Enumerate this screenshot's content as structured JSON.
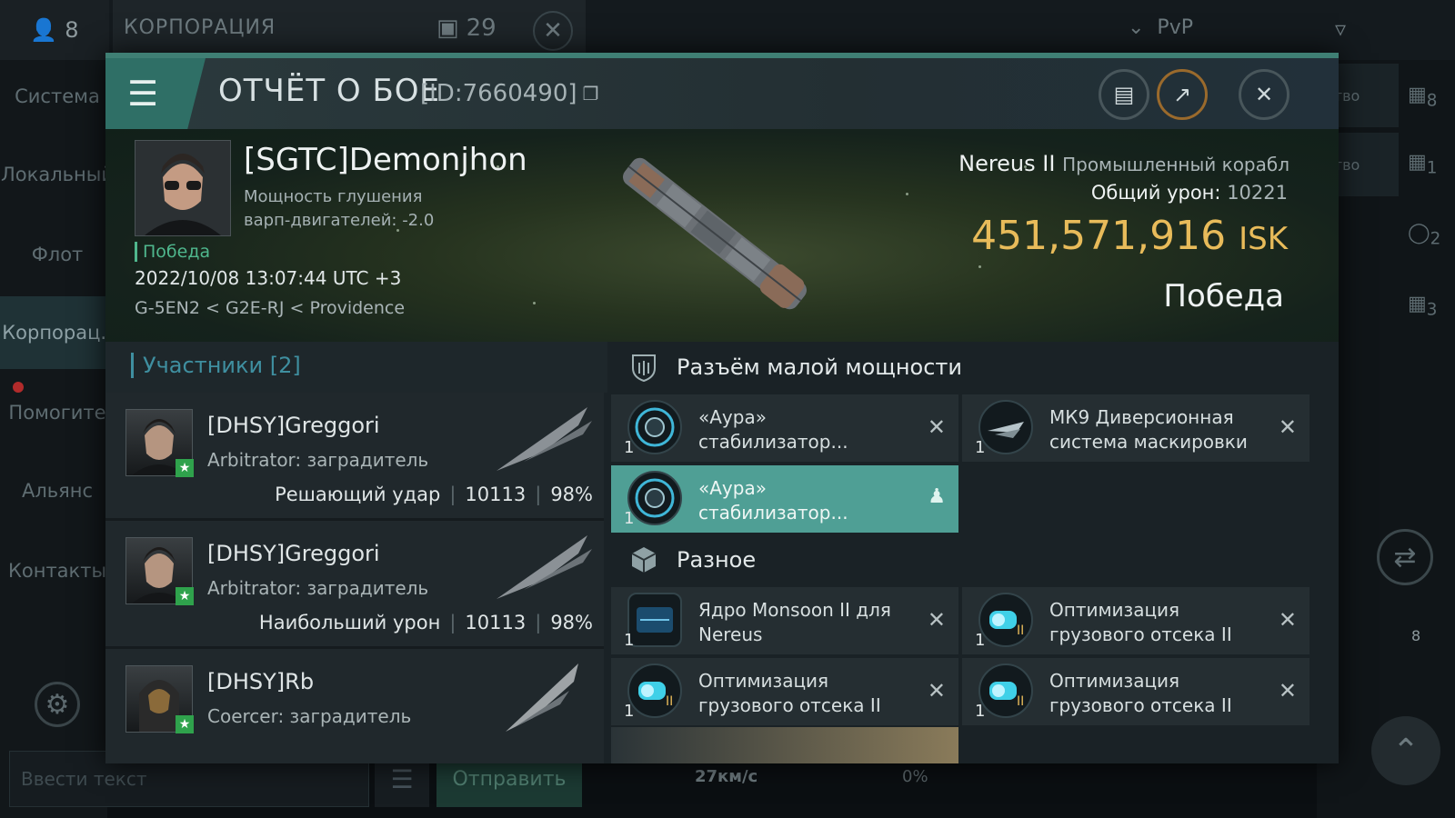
{
  "topbar": {
    "member_count": "8",
    "corp_title": "КОРПОРАЦИЯ",
    "message_count": "29",
    "pvp_label": "PvP"
  },
  "sidebar": {
    "items": [
      {
        "label": "Система"
      },
      {
        "label": "Локальный"
      },
      {
        "label": "Флот"
      },
      {
        "label": "Корпорац.."
      },
      {
        "label": "Помогите"
      },
      {
        "label": "Альянс"
      },
      {
        "label": "Контакты"
      }
    ]
  },
  "chat": {
    "input_placeholder": "Ввести текст",
    "send_label": "Отправить"
  },
  "right_panel": {
    "tabs": [
      {
        "label": "ство"
      },
      {
        "label": "ство"
      }
    ],
    "icon_counts": [
      "8",
      "1",
      "2",
      "3"
    ],
    "badge_count": "8"
  },
  "bottom": {
    "speed": "27км/с",
    "percent": "0%"
  },
  "report": {
    "title": "ОТЧЁТ О БОЕ",
    "id": "[ID:7660490]",
    "victim": {
      "name": "[SGTC]Demonjhon",
      "warp_line1": "Мощность глушения",
      "warp_line2": "варп-двигателей: -2.0",
      "status_label": "Победа",
      "datetime": "2022/10/08 13:07:44 UTC +3",
      "location": "G-5EN2 < G2E-RJ < Providence",
      "ship_name": "Nereus II",
      "ship_type": "Промышленный корабл",
      "total_damage_label": "Общий урон:",
      "total_damage": "10221",
      "isk_value": "451,571,916",
      "isk_currency": "ISK",
      "result": "Победа"
    },
    "participants_title": "Участники [2]",
    "participants": [
      {
        "name": "[DHSY]Greggori",
        "ship": "Arbitrator: заградитель",
        "role": "Решающий удар",
        "damage": "10113",
        "percent": "98%"
      },
      {
        "name": "[DHSY]Greggori",
        "ship": "Arbitrator: заградитель",
        "role": "Наибольший урон",
        "damage": "10113",
        "percent": "98%"
      },
      {
        "name": "[DHSY]Rb",
        "ship": "Coercer: заградитель",
        "role": "",
        "damage": "",
        "percent": ""
      }
    ],
    "low_slot_title": "Разъём малой мощности",
    "low_slots": [
      {
        "qty": "1",
        "name": "«Аура» стабилизатор...",
        "state": "destroyed"
      },
      {
        "qty": "1",
        "name": "МК9 Диверсионная система маскировки",
        "state": "destroyed"
      },
      {
        "qty": "1",
        "name": "«Аура» стабилизатор...",
        "state": "selected"
      }
    ],
    "misc_title": "Разное",
    "misc": [
      {
        "qty": "1",
        "name": "Ядро Monsoon II для Nereus",
        "state": "destroyed"
      },
      {
        "qty": "1",
        "name": "Оптимизация грузового отсека II",
        "state": "destroyed"
      },
      {
        "qty": "1",
        "name": "Оптимизация грузового отсека II",
        "state": "destroyed"
      },
      {
        "qty": "1",
        "name": "Оптимизация грузового отсека II",
        "state": "destroyed"
      }
    ]
  },
  "colors": {
    "accent": "#2f6f66",
    "isk": "#e8bb5a",
    "victory": "#4fb78d",
    "selected": "#4f9f95"
  }
}
